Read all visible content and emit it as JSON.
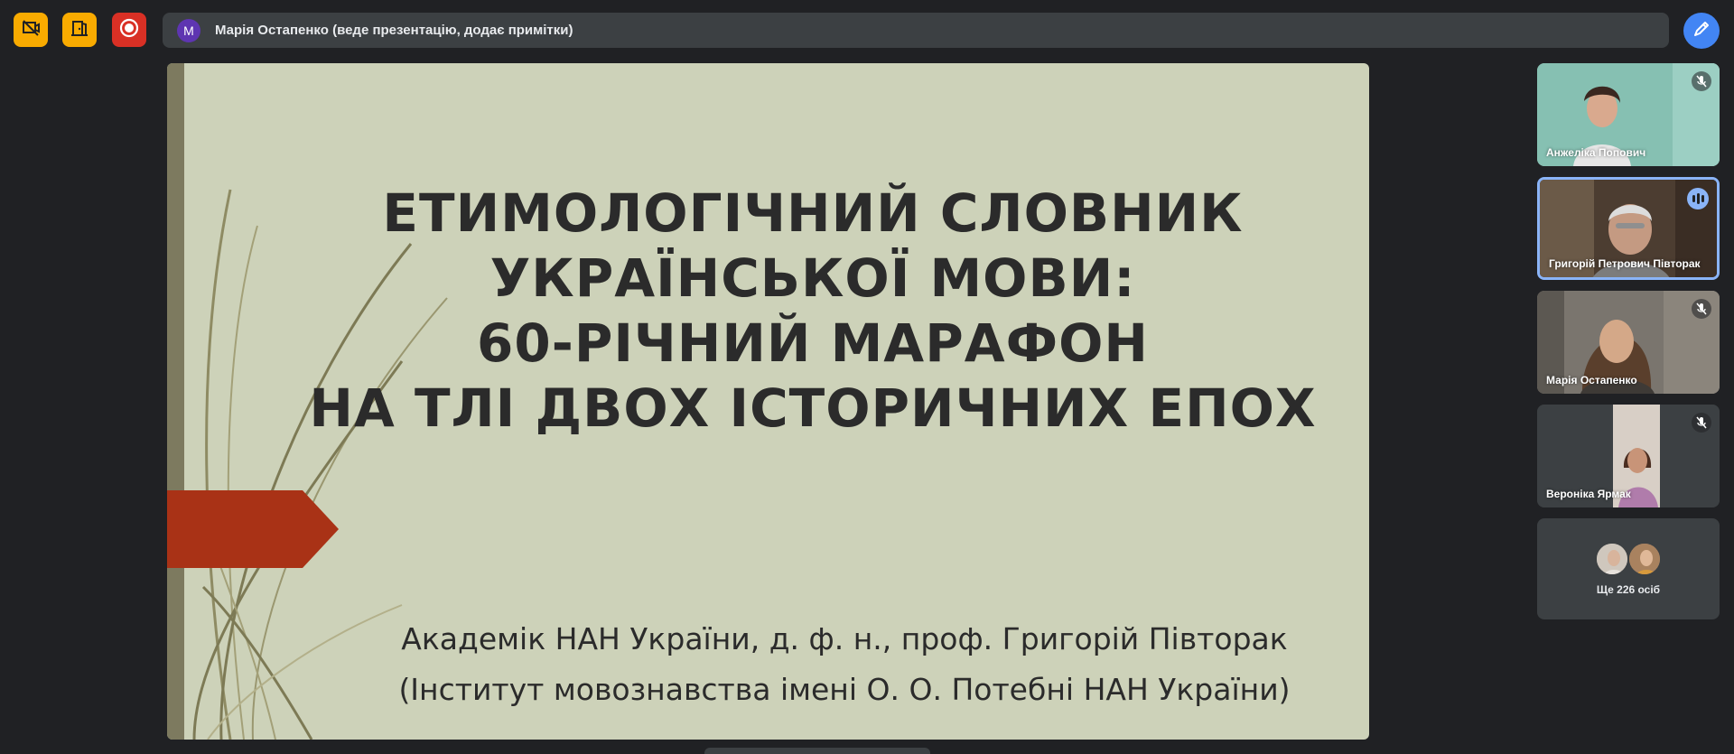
{
  "topbar": {
    "banner_avatar_letter": "M",
    "banner_text": "Марія Остапенко (веде презентацію, додає примітки)",
    "buttons": [
      "camera-off-icon",
      "leave-door-icon",
      "record-icon"
    ],
    "colors": {
      "yellow": "#f9ab00",
      "red": "#d93025",
      "blue": "#4285f4",
      "accent": "#8ab4f8"
    }
  },
  "slide": {
    "title_lines": [
      "ЕТИМОЛОГІЧНИЙ  СЛОВНИК",
      "УКРАЇНСЬКОЇ МОВИ:",
      "60-РІЧНИЙ МАРАФОН",
      "НА ТЛІ ДВОХ ІСТОРИЧНИХ ЕПОХ"
    ],
    "subtitle_lines": [
      "Академік НАН України, д. ф. н., проф. Григорій Півторак",
      "(Інститут мовознавства імені О. О. Потебні НАН України)"
    ],
    "colors": {
      "background": "#cdd2b9",
      "bar": "#7d7a5f",
      "arrow": "#a93216"
    }
  },
  "participants": [
    {
      "name": "Анжеліка Попович",
      "muted": true
    },
    {
      "name": "Григорій Петрович Півторак",
      "speaking": true
    },
    {
      "name": "Марія Остапенко",
      "muted": true
    },
    {
      "name": "Вероніка Ярмак",
      "muted": true
    }
  ],
  "more": {
    "label": "Ще 226 осіб"
  }
}
